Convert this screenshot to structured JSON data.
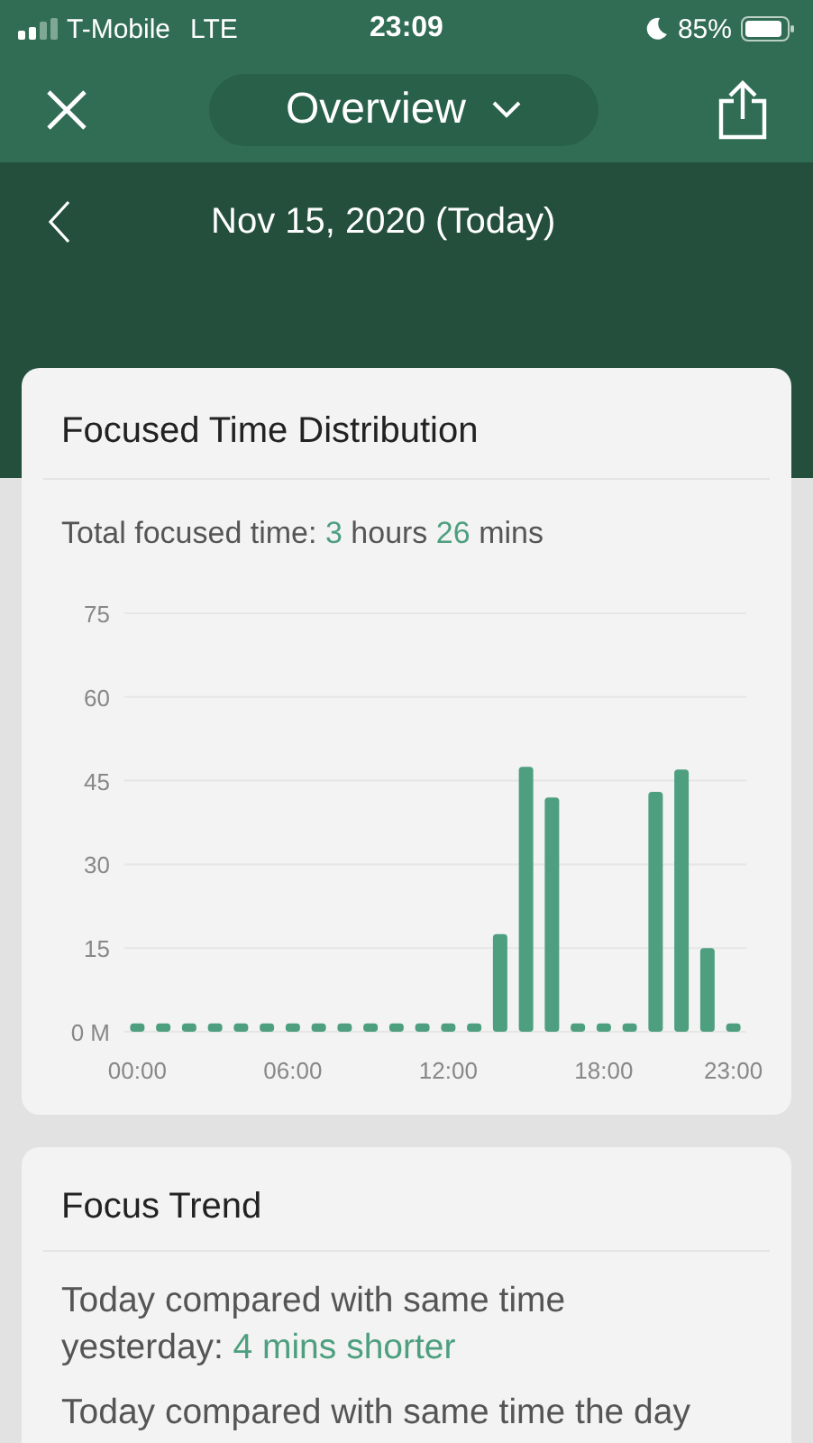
{
  "status_bar": {
    "carrier": "T-Mobile",
    "network": "LTE",
    "time": "23:09",
    "battery": "85%"
  },
  "nav": {
    "title": "Overview"
  },
  "date_bar": {
    "date": "Nov 15, 2020 (Today)"
  },
  "distribution_card": {
    "title": "Focused Time Distribution",
    "total_label": "Total focused time:",
    "hours": "3",
    "hours_unit": "hours",
    "mins": "26",
    "mins_unit": "mins",
    "chart_data": {
      "type": "bar",
      "grid": true,
      "x": [
        0,
        1,
        2,
        3,
        4,
        5,
        6,
        7,
        8,
        9,
        10,
        11,
        12,
        13,
        14,
        15,
        16,
        17,
        18,
        19,
        20,
        21,
        22,
        23
      ],
      "series": [
        {
          "color": "#4e9f80",
          "values": [
            1.5,
            1.5,
            1.5,
            1.5,
            1.5,
            1.5,
            1.5,
            1.5,
            1.5,
            1.5,
            1.5,
            1.5,
            1.5,
            1.5,
            17.5,
            47.5,
            42,
            1.5,
            1.5,
            1.5,
            43,
            47,
            15,
            1.5
          ]
        }
      ],
      "xlim": [
        -0.5,
        23.5
      ],
      "ylim": [
        0,
        75
      ],
      "yticks": [
        {
          "value": 0,
          "label": "0 M"
        },
        15,
        30,
        45,
        60,
        75
      ],
      "xticks": [
        {
          "value": 0,
          "label": "00:00"
        },
        {
          "value": 6,
          "label": "06:00"
        },
        {
          "value": 12,
          "label": "12:00"
        },
        {
          "value": 18,
          "label": "18:00"
        },
        {
          "value": 23,
          "label": "23:00"
        }
      ]
    }
  },
  "trend_card": {
    "title": "Focus Trend",
    "lines": [
      {
        "text": "Today compared with same time yesterday:",
        "highlight": "4 mins shorter"
      },
      {
        "text": "Today compared with same time the day"
      }
    ]
  }
}
